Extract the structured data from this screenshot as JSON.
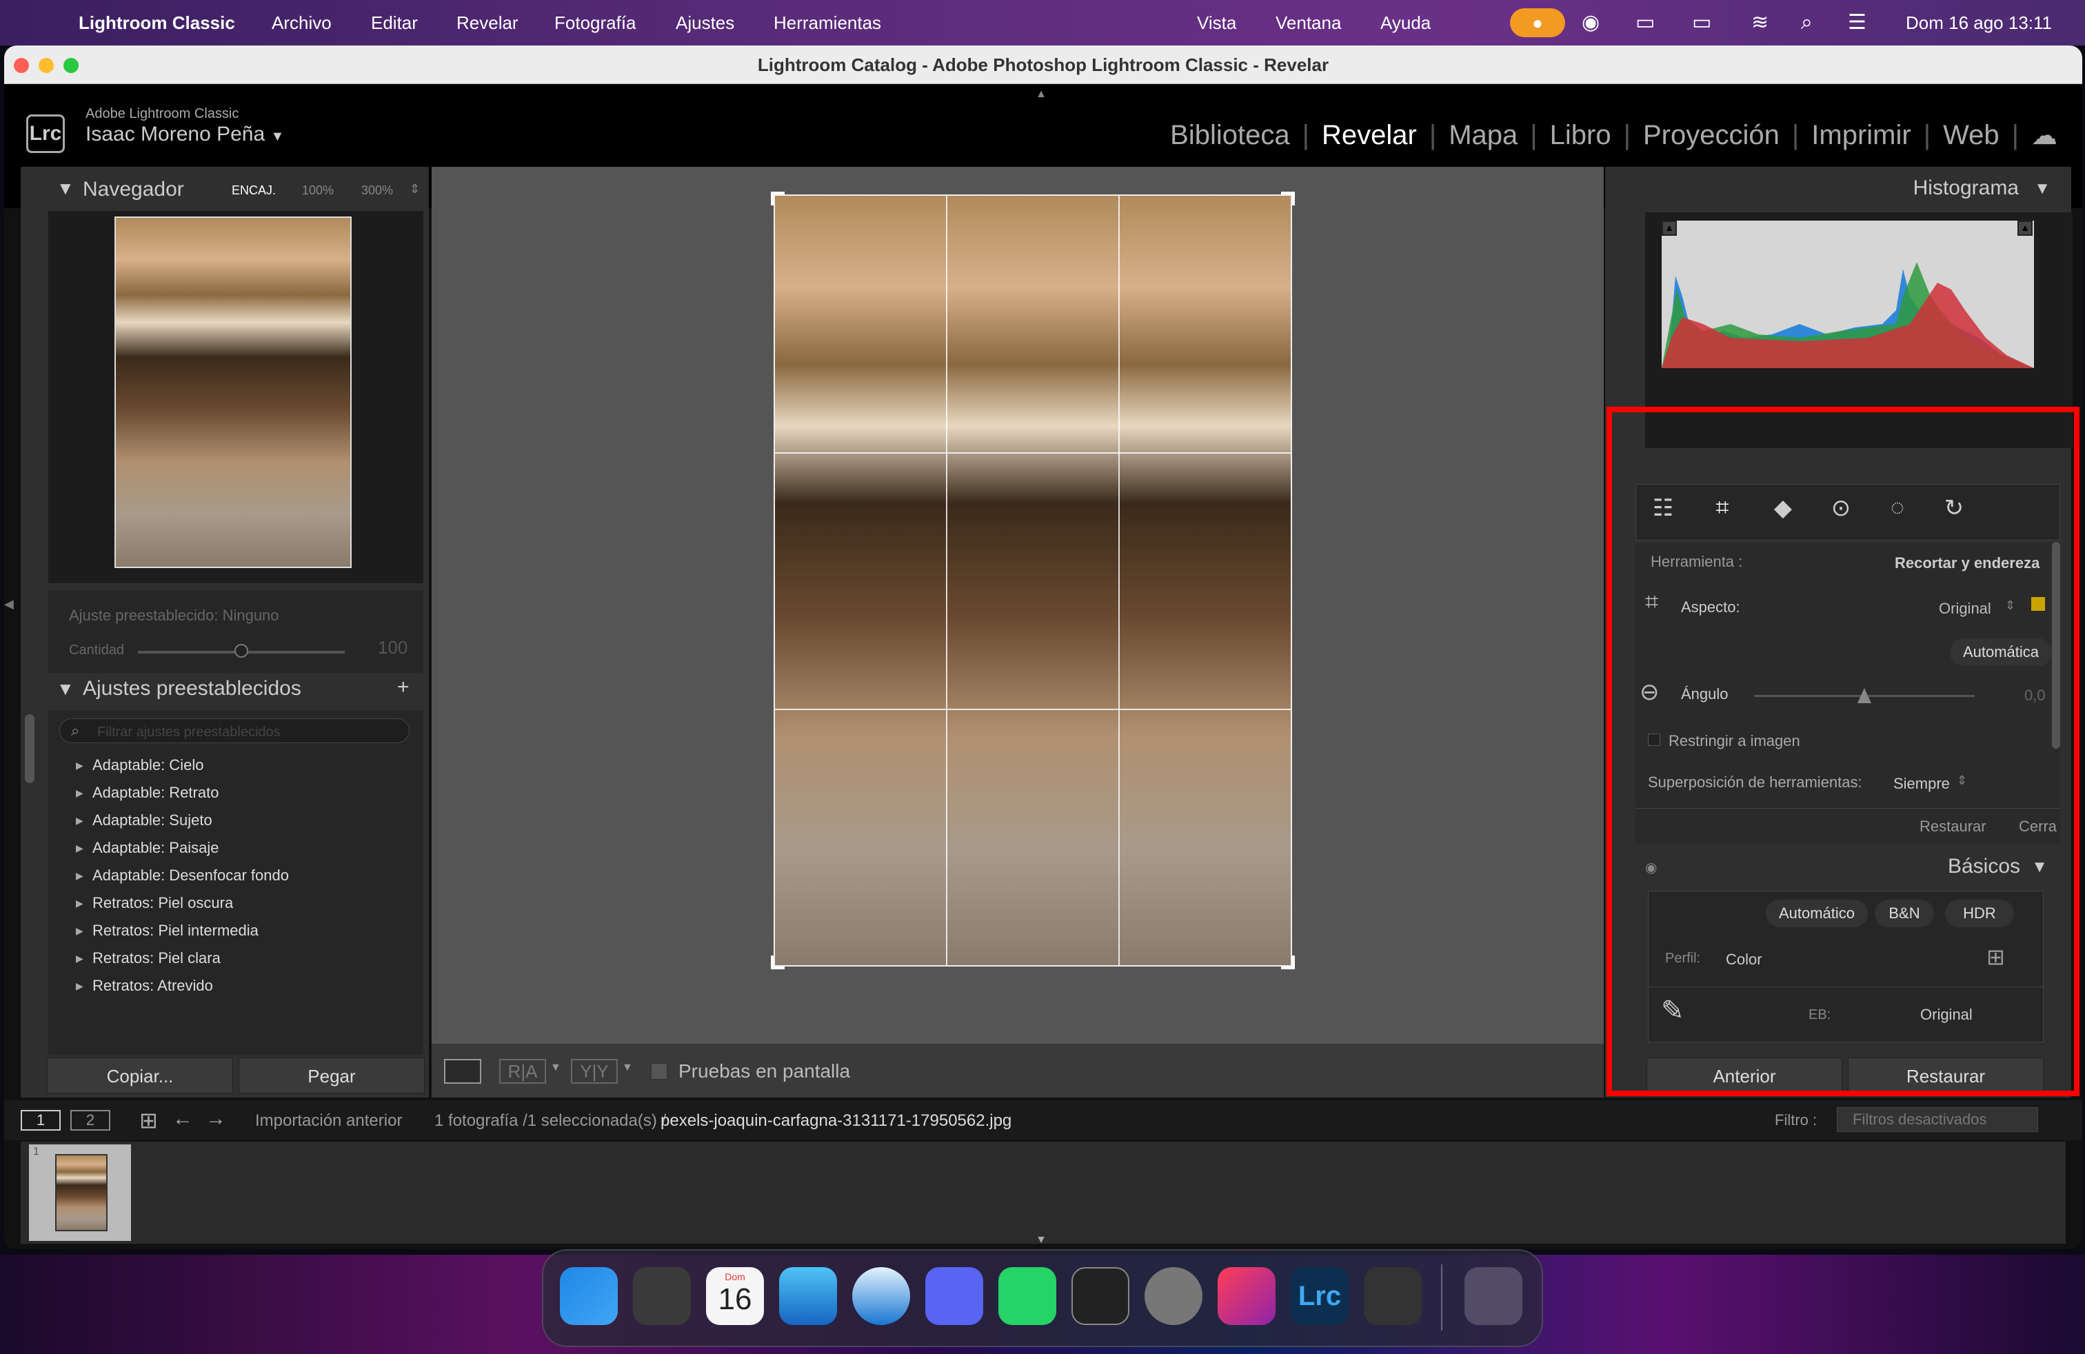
{
  "menubar": {
    "app": "Lightroom Classic",
    "items": [
      "Archivo",
      "Editar",
      "Revelar",
      "Fotografía",
      "Ajustes",
      "Herramientas"
    ],
    "right_items": [
      "Vista",
      "Ventana",
      "Ayuda"
    ],
    "datetime": "Dom 16 ago 13:11"
  },
  "window": {
    "title": "Lightroom Catalog - Adobe Photoshop Lightroom Classic - Revelar"
  },
  "identity": {
    "product": "Adobe Lightroom Classic",
    "user": "Isaac Moreno Peña",
    "logo": "Lrc"
  },
  "modules": [
    "Biblioteca",
    "Revelar",
    "Mapa",
    "Libro",
    "Proyección",
    "Imprimir",
    "Web"
  ],
  "active_module": "Revelar",
  "navigator": {
    "title": "Navegador",
    "zoom": [
      "ENCAJ.",
      "100%",
      "300%"
    ]
  },
  "preset_amount": {
    "label": "Ajuste preestablecido: Ninguno",
    "amount_label": "Cantidad",
    "amount_value": "100",
    "amount_fraction": 0.5
  },
  "presets": {
    "title": "Ajustes preestablecidos",
    "search_placeholder": "Filtrar ajustes preestablecidos",
    "items": [
      "Adaptable: Cielo",
      "Adaptable: Retrato",
      "Adaptable: Sujeto",
      "Adaptable: Paisaje",
      "Adaptable: Desenfocar fondo",
      "Retratos: Piel oscura",
      "Retratos: Piel intermedia",
      "Retratos: Piel clara",
      "Retratos: Atrevido"
    ]
  },
  "left_buttons": {
    "copy": "Copiar...",
    "paste": "Pegar"
  },
  "toolbar": {
    "proof": "Pruebas en pantalla",
    "ra": "R|A",
    "yy": "Y|Y"
  },
  "histogram": {
    "title": "Histograma"
  },
  "crop": {
    "tool_label": "Herramienta :",
    "tool_value": "Recortar y endereza",
    "aspect_label": "Aspecto:",
    "aspect_value": "Original",
    "auto": "Automática",
    "angle_label": "Ángulo",
    "angle_value": "0,0",
    "angle_fraction": 0.5,
    "constrain": "Restringir a imagen",
    "overlay_label": "Superposición de herramientas:",
    "overlay_value": "Siempre",
    "reset": "Restaurar",
    "close": "Cerra"
  },
  "basic": {
    "title": "Básicos",
    "buttons": [
      "Automático",
      "B&N",
      "HDR"
    ],
    "profile_label": "Perfil:",
    "profile_value": "Color",
    "wb_label": "EB:",
    "wb_value": "Original"
  },
  "right_buttons": {
    "previous": "Anterior",
    "reset": "Restaurar"
  },
  "filmstrip": {
    "page1": "1",
    "page2": "2",
    "source": "Importación anterior",
    "info": "1 fotografía /1 seleccionada(s) /",
    "filename": "pexels-joaquin-carfagna-3131171-17950562.jpg",
    "filter_label": "Filtro :",
    "filter_value": "Filtros desactivados",
    "thumb_index": "1"
  },
  "dock": {
    "items": [
      "finder-icon",
      "launchpad-icon",
      "calendar-icon",
      "mail-icon",
      "safari-icon",
      "discord-icon",
      "whatsapp-icon",
      "davinci-icon",
      "settings-icon",
      "creative-cloud-icon",
      "lightroom-icon",
      "disk-utility-icon",
      "trash-icon"
    ],
    "calendar_day": "Dom",
    "calendar_date": "16"
  },
  "colors": {
    "highlight": "#ff0000",
    "accent_orange": "#f39a22"
  }
}
